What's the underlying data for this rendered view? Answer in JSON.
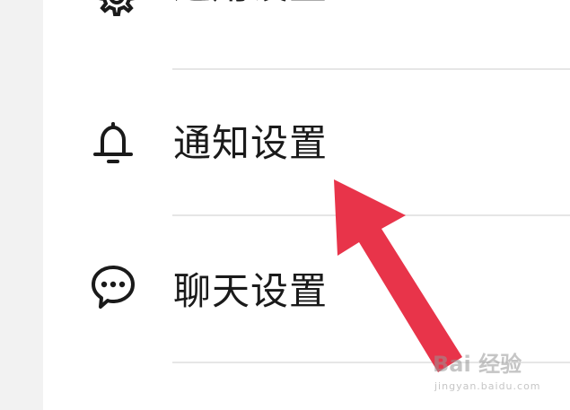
{
  "settings": {
    "items": [
      {
        "label": "通用设置",
        "icon": "gear-icon"
      },
      {
        "label": "通知设置",
        "icon": "bell-icon"
      },
      {
        "label": "聊天设置",
        "icon": "chat-bubble-icon"
      }
    ]
  },
  "annotation": {
    "arrow_color": "#e8344a",
    "arrow_icon": "annotation-arrow-icon"
  },
  "watermark": {
    "main": "Bai 经验",
    "sub": "jingyan.baidu.com"
  }
}
